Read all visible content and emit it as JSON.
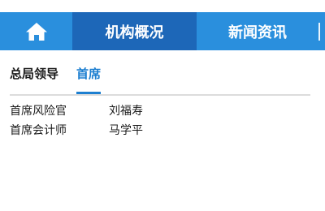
{
  "nav": {
    "home_icon": "home-icon",
    "tabs": [
      {
        "label": "机构概况",
        "active": true
      },
      {
        "label": "新闻资讯",
        "active": false
      }
    ],
    "accent_color": "#2a8fdd",
    "active_color": "#1d67b8"
  },
  "subtabs": [
    {
      "label": "总局领导",
      "active": false
    },
    {
      "label": "首席",
      "active": true
    }
  ],
  "leaders": [
    {
      "role": "首席风险官",
      "name": "刘福寿"
    },
    {
      "role": "首席会计师",
      "name": "马学平"
    }
  ]
}
